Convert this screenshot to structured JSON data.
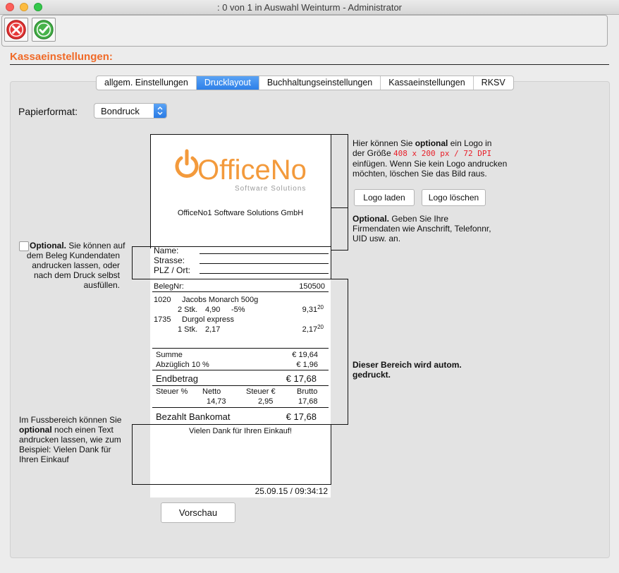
{
  "window": {
    "title": ": 0 von 1 in Auswahl Weinturm - Administrator"
  },
  "section_title": "Kassaeinstellungen:",
  "tabs": [
    {
      "label": "allgem. Einstellungen",
      "active": false
    },
    {
      "label": "Drucklayout",
      "active": true
    },
    {
      "label": "Buchhaltungseinstellungen",
      "active": false
    },
    {
      "label": "Kassaeinstellungen",
      "active": false
    },
    {
      "label": "RKSV",
      "active": false
    }
  ],
  "papierformat": {
    "label": "Papierformat:",
    "value": "Bondruck"
  },
  "logo": {
    "brand": "OfficeNo1",
    "tagline": "Software Solutions"
  },
  "company_name": "OfficeNo1 Software Solutions GmbH",
  "customer": {
    "name_label": "Name:",
    "strasse_label": "Strasse:",
    "plz_label": "PLZ / Ort:"
  },
  "beleg": {
    "label": "BelegNr:",
    "value": "150500"
  },
  "items": [
    {
      "code": "1020",
      "name": "Jacobs Monarch 500g",
      "qty": "2 Stk.",
      "price": "4,90",
      "discount": "-5%",
      "total": "9,31",
      "total_sup": "20"
    },
    {
      "code": "1735",
      "name": "Durgol express",
      "qty": "1 Stk.",
      "price": "2,17",
      "discount": "",
      "total": "2,17",
      "total_sup": "20"
    }
  ],
  "totals": {
    "summe_label": "Summe",
    "summe_value": "€ 19,64",
    "abz_label": "Abzüglich 10 %",
    "abz_value": "€ 1,96",
    "end_label": "Endbetrag",
    "end_value": "€ 17,68"
  },
  "tax": {
    "headers": [
      "Steuer %",
      "Netto",
      "Steuer €",
      "Brutto"
    ],
    "row": [
      "",
      "14,73",
      "2,95",
      "17,68"
    ]
  },
  "bezahlt": {
    "label": "Bezahlt Bankomat",
    "value": "€ 17,68"
  },
  "footer_text": "Vielen Dank für Ihren Einkauf!",
  "datetime": "25.09.15 / 09:34:12",
  "buttons": {
    "logo_laden": "Logo laden",
    "logo_loeschen": "Logo löschen",
    "vorschau": "Vorschau"
  },
  "notes": {
    "logo_1": "Hier können Sie ",
    "logo_bold": "optional",
    "logo_2": " ein Logo in",
    "logo_3": "der Größe ",
    "logo_size": "408 x 200 px / 72 DPI",
    "logo_4": "einfügen. Wenn Sie kein Logo andrucken",
    "logo_5": "möchten, löschen Sie das Bild raus.",
    "firm_bold": "Optional.",
    "firm_1": " Geben Sie Ihre",
    "firm_2": "Firmendaten wie Anschrift, Telefonnr,",
    "firm_3": "UID usw. an.",
    "cust_bold": "Optional.",
    "cust_1": " Sie können auf",
    "cust_2": "dem Beleg Kundendaten",
    "cust_3": "andrucken lassen, oder",
    "cust_4": "nach dem Druck selbst",
    "cust_5": "ausfüllen.",
    "auto_1": "Dieser Bereich wird autom.",
    "auto_2": "gedruckt.",
    "foot_1": "Im Fussbereich können Sie",
    "foot_bold": "optional",
    "foot_2": " noch einen Text",
    "foot_3": "andrucken lassen, wie zum",
    "foot_4": "Beispiel: Vielen Dank für",
    "foot_5": "Ihren Einkauf"
  },
  "colors": {
    "accent": "#f06a28",
    "tab_active": "#2d7fe8",
    "logo_orange": "#f39a3c",
    "logo_gray": "#9a9a9a"
  }
}
